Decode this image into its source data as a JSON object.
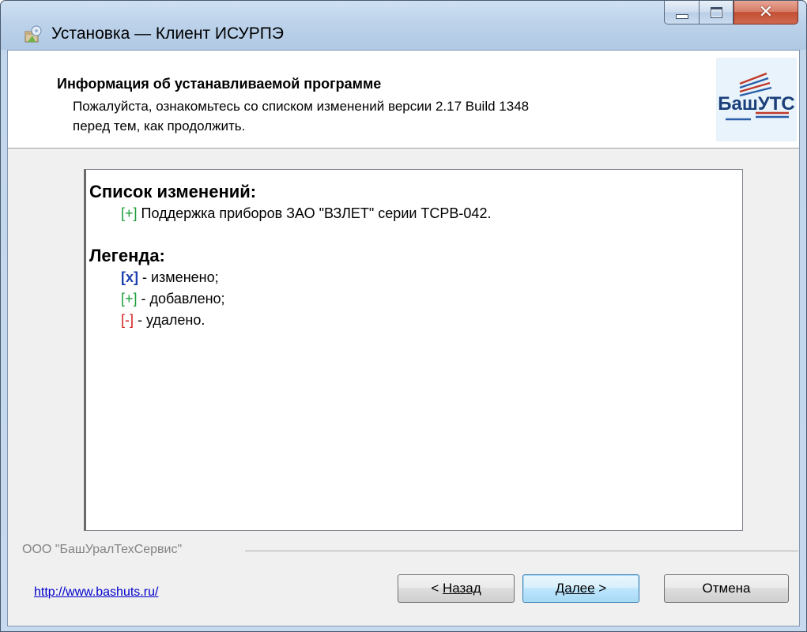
{
  "window": {
    "title": "Установка — Клиент ИСУРПЭ"
  },
  "header": {
    "title": "Информация об устанавливаемой программе",
    "desc_line1": "Пожалуйста, ознакомьтесь со списком изменений версии 2.17 Build 1348",
    "desc_line2": "перед тем, как продолжить.",
    "logo_text": "БашУТС"
  },
  "memo": {
    "changes_heading": "Список изменений:",
    "changes": [
      {
        "tag": "[+]",
        "text": " Поддержка приборов ЗАО \"ВЗЛЕТ\" серии ТСРВ-042."
      }
    ],
    "legend_heading": "Легенда:",
    "legend": [
      {
        "tag": "[x]",
        "text": " - изменено;"
      },
      {
        "tag": "[+]",
        "text": " - добавлено;"
      },
      {
        "tag": "[-]",
        "text": " - удалено."
      }
    ]
  },
  "footer": {
    "company": "ООО \"БашУралТехСервис\"",
    "link": "http://www.bashuts.ru/",
    "back_prefix": "< ",
    "back_label": "Назад",
    "next_label": "Далее",
    "next_suffix": " >",
    "cancel_label": "Отмена"
  },
  "colors": {
    "added": "#1a9e3a",
    "changed": "#1a3fb0",
    "removed": "#d41c1c",
    "link": "#0000cc"
  }
}
